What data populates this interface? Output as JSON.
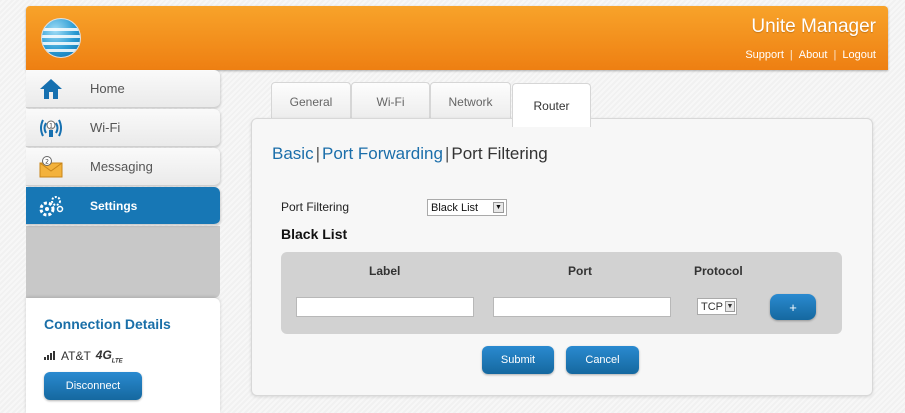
{
  "header": {
    "app_title": "Unite Manager",
    "links": [
      "Support",
      "About",
      "Logout"
    ],
    "accent": "#f28f1c"
  },
  "sidebar": {
    "items": [
      {
        "label": "Home",
        "icon": "home-icon"
      },
      {
        "label": "Wi-Fi",
        "icon": "wifi-icon"
      },
      {
        "label": "Messaging",
        "icon": "messaging-icon"
      },
      {
        "label": "Settings",
        "icon": "settings-icon",
        "active": true
      }
    ],
    "connection": {
      "title": "Connection Details",
      "carrier": "AT&T",
      "network": "4G",
      "network_sub": "LTE",
      "disconnect_label": "Disconnect"
    }
  },
  "tabs": [
    {
      "label": "General"
    },
    {
      "label": "Wi-Fi"
    },
    {
      "label": "Network"
    },
    {
      "label": "Router",
      "active": true
    }
  ],
  "content": {
    "breadcrumb": {
      "basic": "Basic",
      "port_forwarding": "Port Forwarding",
      "port_filtering": "Port Filtering"
    },
    "port_filtering_label": "Port Filtering",
    "port_filtering_value": "Black List",
    "section_title": "Black List",
    "table": {
      "headers": {
        "label": "Label",
        "port": "Port",
        "protocol": "Protocol"
      },
      "label_value": "",
      "port_value": "",
      "protocol_value": "TCP",
      "add_label": "+"
    },
    "submit_label": "Submit",
    "cancel_label": "Cancel"
  },
  "colors": {
    "primary_blue": "#1777b5",
    "link_blue": "#1b6eaa",
    "header_orange": "#ee7f12"
  }
}
